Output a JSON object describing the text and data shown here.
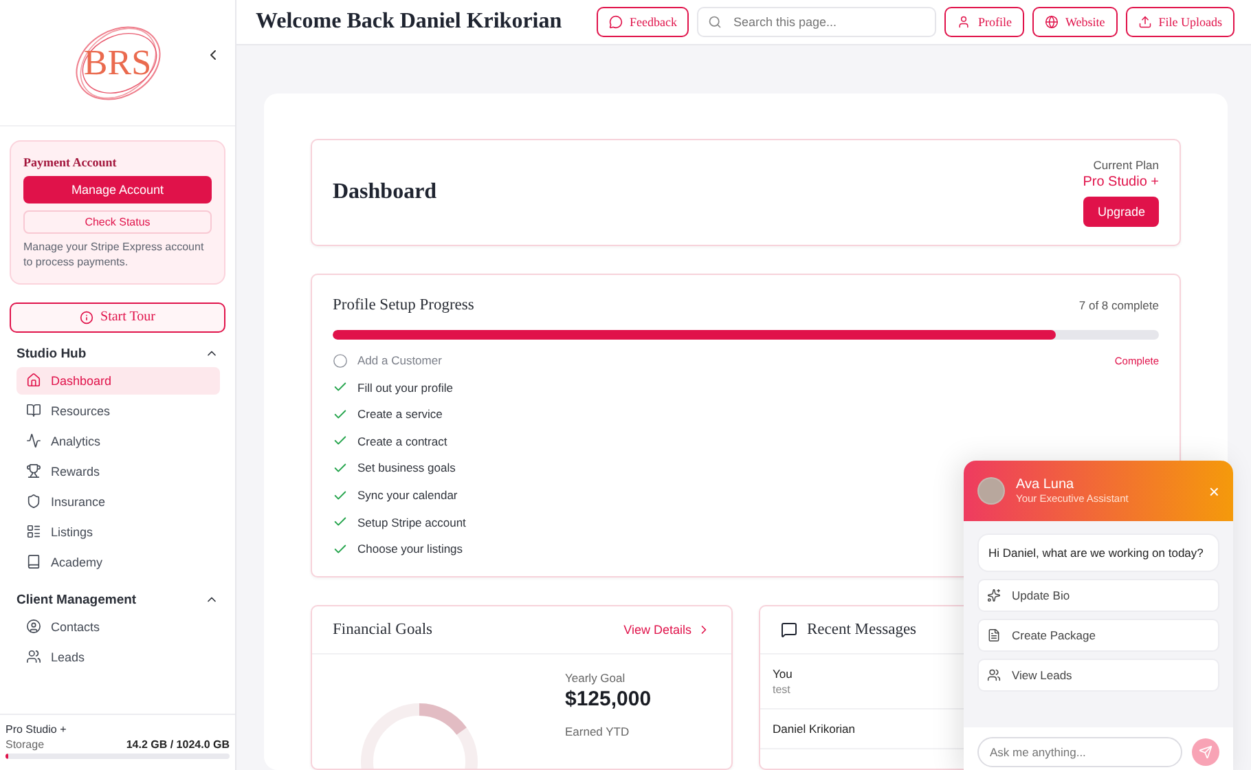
{
  "sidebar": {
    "logo": "BRS",
    "payment": {
      "title": "Payment Account",
      "primary": "Manage Account",
      "secondary": "Check Status",
      "note": "Manage your Stripe Express account to process payments."
    },
    "tour": "Start Tour",
    "sections": [
      {
        "title": "Studio Hub",
        "expanded": true,
        "items": [
          {
            "label": "Dashboard",
            "selected": true
          },
          {
            "label": "Resources",
            "selected": false
          },
          {
            "label": "Analytics",
            "selected": false
          },
          {
            "label": "Rewards",
            "selected": false
          },
          {
            "label": "Insurance",
            "selected": false
          },
          {
            "label": "Listings",
            "selected": false
          },
          {
            "label": "Academy",
            "selected": false
          }
        ]
      },
      {
        "title": "Client Management",
        "expanded": true,
        "items": [
          {
            "label": "Contacts",
            "selected": false
          },
          {
            "label": "Leads",
            "selected": false
          }
        ]
      }
    ],
    "plan": "Pro Studio +",
    "storage_label": "Storage",
    "storage_value": "14.2 GB / 1024.0 GB",
    "storage": {
      "level": 0.014
    }
  },
  "header": {
    "title": "Welcome Back Daniel Krikorian",
    "feedback": "Feedback",
    "search": {
      "placeholder": "Search this page..."
    },
    "buttons": [
      {
        "label": "Profile"
      },
      {
        "label": "Website"
      },
      {
        "label": "File Uploads"
      }
    ]
  },
  "dashboard": {
    "title": "Dashboard",
    "plan_label": "Current Plan",
    "plan": "Pro Studio +",
    "upgrade": "Upgrade"
  },
  "progress": {
    "title": "Profile Setup Progress",
    "count": "7 of 8 complete",
    "bar": {
      "level": 0.875
    },
    "action": "Complete",
    "tasks": [
      {
        "label": "Add a Customer",
        "done": false
      },
      {
        "label": "Fill out your profile",
        "done": true
      },
      {
        "label": "Create a service",
        "done": true
      },
      {
        "label": "Create a contract",
        "done": true
      },
      {
        "label": "Set business goals",
        "done": true
      },
      {
        "label": "Sync your calendar",
        "done": true
      },
      {
        "label": "Setup Stripe account",
        "done": true
      },
      {
        "label": "Choose your listings",
        "done": true
      }
    ]
  },
  "financial": {
    "title": "Financial Goals",
    "link": "View Details",
    "ring": {
      "level": 0.15
    },
    "goal_label": "Yearly Goal",
    "goal": "$125,000",
    "earned_label": "Earned YTD"
  },
  "messages": {
    "title": "Recent Messages",
    "items": [
      {
        "sender": "You",
        "text": "test"
      },
      {
        "sender": "Daniel Krikorian"
      }
    ]
  },
  "chat": {
    "name": "Ava Luna",
    "role": "Your Executive Assistant",
    "close": "×",
    "greeting": "Hi Daniel, what are we working on today?",
    "actions": [
      {
        "label": "Update Bio"
      },
      {
        "label": "Create Package"
      },
      {
        "label": "View Leads"
      }
    ],
    "input": {
      "placeholder": "Ask me anything..."
    },
    "send": {
      "disabled": true
    }
  }
}
